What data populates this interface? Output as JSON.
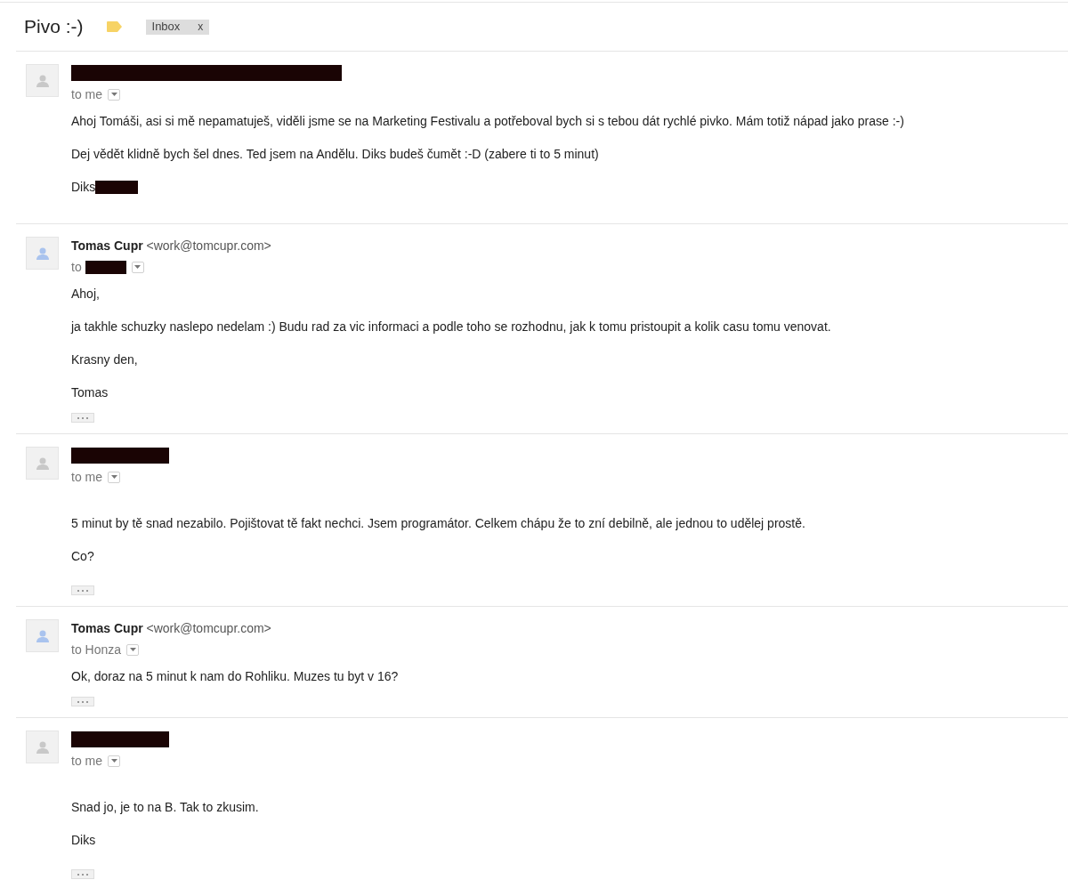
{
  "thread": {
    "subject": "Pivo :-)",
    "important": true,
    "labels": [
      {
        "text": "Inbox",
        "remove": "x"
      }
    ]
  },
  "messages": [
    {
      "sender": {
        "redacted": true
      },
      "color": "#c8c8c8",
      "recipient": {
        "text": "to me",
        "redacted": false
      },
      "spaced": false,
      "paragraphs": [
        {
          "text": "Ahoj Tomáši, asi si mě nepamatuješ, viděli jsme se na Marketing Festivalu a potřeboval bych si s tebou dát rychlé pivko. Mám totiž nápad jako prase :-)",
          "redacted_after": false
        },
        {
          "text": "Dej vědět klidně bych šel dnes. Ted jsem na Andělu. Diks budeš čumět :-D (zabere ti to 5 minut)",
          "redacted_after": false
        },
        {
          "text": "Diks",
          "redacted_after": true
        }
      ],
      "collapsed_quote": false
    },
    {
      "sender": {
        "redacted": false,
        "name": "Tomas Cupr",
        "email": "<work@tomcupr.com>"
      },
      "color": "#a9c3ee",
      "recipient": {
        "text": "to",
        "redacted": true
      },
      "spaced": false,
      "paragraphs": [
        {
          "text": "Ahoj,",
          "redacted_after": false
        },
        {
          "text": "ja takhle schuzky naslepo nedelam :) Budu rad za vic informaci a podle toho se rozhodnu, jak k tomu pristoupit a kolik casu tomu venovat.",
          "redacted_after": false
        },
        {
          "text": "Krasny den,",
          "redacted_after": false
        },
        {
          "text": "Tomas",
          "redacted_after": false
        }
      ],
      "collapsed_quote": true
    },
    {
      "sender": {
        "redacted": true
      },
      "color": "#c8c8c8",
      "recipient": {
        "text": "to me",
        "redacted": false
      },
      "spaced": true,
      "paragraphs": [
        {
          "text": "5 minut by tě snad nezabilo. Pojištovat tě fakt nechci. Jsem programátor. Celkem chápu že to zní debilně, ale jednou to udělej prostě.",
          "redacted_after": false
        },
        {
          "text": "Co?",
          "redacted_after": false
        }
      ],
      "collapsed_quote": true
    },
    {
      "sender": {
        "redacted": false,
        "name": "Tomas Cupr",
        "email": "<work@tomcupr.com>"
      },
      "color": "#a9c3ee",
      "recipient": {
        "text": "to Honza",
        "redacted": false
      },
      "spaced": false,
      "paragraphs": [
        {
          "text": "Ok, doraz na 5 minut k nam do Rohliku. Muzes tu byt v 16?",
          "redacted_after": false
        }
      ],
      "collapsed_quote": true
    },
    {
      "sender": {
        "redacted": true
      },
      "color": "#c8c8c8",
      "recipient": {
        "text": "to me",
        "redacted": false
      },
      "spaced": true,
      "paragraphs": [
        {
          "text": "Snad jo, je to na B. Tak to zkusim.",
          "redacted_after": false
        },
        {
          "text": "Diks",
          "redacted_after": false
        }
      ],
      "collapsed_quote": true
    }
  ]
}
